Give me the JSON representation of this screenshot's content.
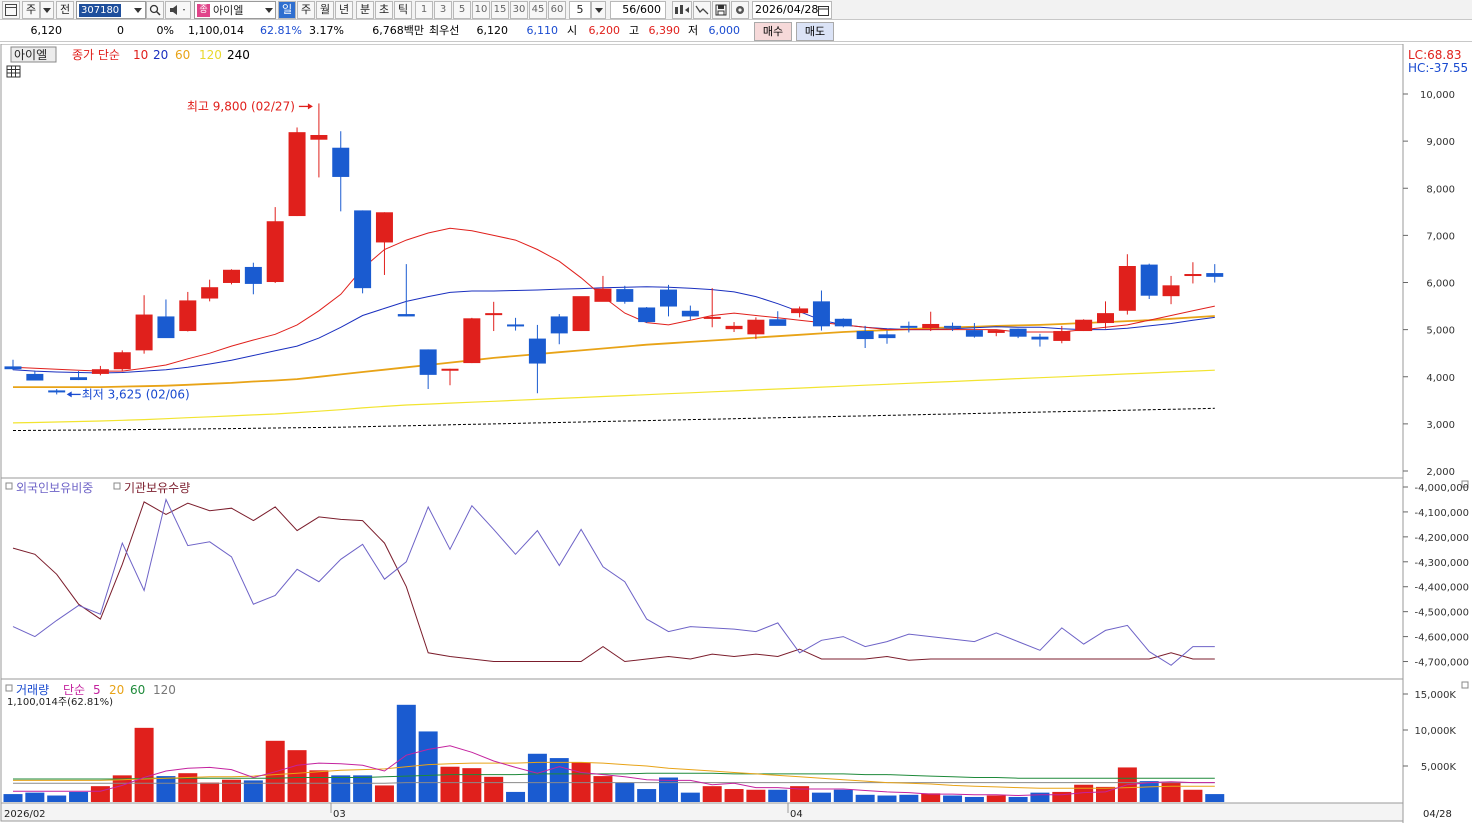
{
  "toolbar": {
    "mode_buttons": [
      "주",
      "전"
    ],
    "code": "307180",
    "stock_name": "아이엘",
    "stock_badge": "종",
    "periods": [
      "일",
      "주",
      "월",
      "년",
      "분",
      "초",
      "틱"
    ],
    "active_period": "일",
    "minute_steps": [
      "1",
      "3",
      "5",
      "10",
      "15",
      "30",
      "45",
      "60"
    ],
    "step_value": "5",
    "count": "56/600",
    "date": "2026/04/28"
  },
  "quote": {
    "price": "6,120",
    "change": "0",
    "change_pct": "0%",
    "volume": "1,100,014",
    "vol_ratio": "62.81%",
    "turnover": "3.17%",
    "amount": "6,768백만",
    "best_label": "최우선",
    "best_ask": "6,120",
    "best_bid": "6,110",
    "open_label": "시",
    "open": "6,200",
    "high_label": "고",
    "high": "6,390",
    "low_label": "저",
    "low": "6,000",
    "buy_label": "매수",
    "sell_label": "매도"
  },
  "price_panel": {
    "name_tag": "아이엘",
    "legend_prefix": "종가 단순",
    "ma_labels": [
      "10",
      "20",
      "60",
      "120",
      "240"
    ],
    "lc": "LC:68.83",
    "hc": "HC:-37.55",
    "high_note": "최고 9,800 (02/27)",
    "low_note": "최저 3,625 (02/06)",
    "y_ticks": [
      "10,000",
      "9,000",
      "8,000",
      "7,000",
      "6,000",
      "5,000",
      "4,000",
      "3,000",
      "2,000"
    ]
  },
  "holdings_panel": {
    "legend_foreign": "외국인보유비중",
    "legend_inst": "기관보유수량",
    "y_ticks": [
      "-4,000,000",
      "-4,100,000",
      "-4,200,000",
      "-4,300,000",
      "-4,400,000",
      "-4,500,000",
      "-4,600,000",
      "-4,700,000"
    ]
  },
  "volume_panel": {
    "legend_prefix": "거래량",
    "legend_ma_prefix": "단순",
    "ma_labels": [
      "5",
      "20",
      "60",
      "120"
    ],
    "current": "1,100,014주(62.81%)",
    "y_ticks": [
      "15,000K",
      "10,000K",
      "5,000K"
    ]
  },
  "xaxis": {
    "labels": [
      "2026/02",
      "03",
      "04"
    ],
    "last_date": "04/28"
  },
  "colors": {
    "up": "#e0201c",
    "down": "#1a5bd0",
    "ma10": "#e0201c",
    "ma20": "#1a2fbf",
    "ma60": "#e8a317",
    "ma120": "#f2e430",
    "ma240": "#000000",
    "foreign_line": "#6e63c7",
    "inst_line": "#7b1d2c"
  },
  "chart_data": {
    "type": "candlestick",
    "candles": [
      {
        "o": 4220,
        "h": 4360,
        "l": 4140,
        "c": 4160
      },
      {
        "o": 4060,
        "h": 4130,
        "l": 3990,
        "c": 3920
      },
      {
        "o": 3710,
        "h": 3740,
        "l": 3625,
        "c": 3700
      },
      {
        "o": 3990,
        "h": 4120,
        "l": 3930,
        "c": 3930
      },
      {
        "o": 4060,
        "h": 4230,
        "l": 4030,
        "c": 4160
      },
      {
        "o": 4160,
        "h": 4560,
        "l": 4120,
        "c": 4520
      },
      {
        "o": 4560,
        "h": 5730,
        "l": 4490,
        "c": 5320
      },
      {
        "o": 5280,
        "h": 5640,
        "l": 4870,
        "c": 4820
      },
      {
        "o": 4970,
        "h": 5800,
        "l": 4960,
        "c": 5620
      },
      {
        "o": 5660,
        "h": 6060,
        "l": 5600,
        "c": 5900
      },
      {
        "o": 5990,
        "h": 6280,
        "l": 5960,
        "c": 6270
      },
      {
        "o": 6330,
        "h": 6420,
        "l": 5750,
        "c": 5970
      },
      {
        "o": 6010,
        "h": 7600,
        "l": 5990,
        "c": 7300
      },
      {
        "o": 7410,
        "h": 9290,
        "l": 7410,
        "c": 9190
      },
      {
        "o": 9030,
        "h": 9800,
        "l": 8230,
        "c": 9130
      },
      {
        "o": 8860,
        "h": 9210,
        "l": 7510,
        "c": 8240
      },
      {
        "o": 7530,
        "h": 7530,
        "l": 5770,
        "c": 5880
      },
      {
        "o": 6850,
        "h": 7490,
        "l": 6160,
        "c": 7490
      },
      {
        "o": 5330,
        "h": 6390,
        "l": 5280,
        "c": 5280
      },
      {
        "o": 4580,
        "h": 4580,
        "l": 3740,
        "c": 4040
      },
      {
        "o": 4170,
        "h": 4170,
        "l": 3820,
        "c": 4170
      },
      {
        "o": 4290,
        "h": 5250,
        "l": 4290,
        "c": 5240
      },
      {
        "o": 5340,
        "h": 5590,
        "l": 4970,
        "c": 5350
      },
      {
        "o": 5110,
        "h": 5250,
        "l": 4980,
        "c": 5080
      },
      {
        "o": 4810,
        "h": 5100,
        "l": 3650,
        "c": 4280
      },
      {
        "o": 5280,
        "h": 5330,
        "l": 4690,
        "c": 4920
      },
      {
        "o": 4970,
        "h": 5660,
        "l": 4970,
        "c": 5710
      },
      {
        "o": 5590,
        "h": 6140,
        "l": 5620,
        "c": 5870
      },
      {
        "o": 5860,
        "h": 5930,
        "l": 5550,
        "c": 5590
      },
      {
        "o": 5470,
        "h": 5480,
        "l": 5140,
        "c": 5160
      },
      {
        "o": 5850,
        "h": 5950,
        "l": 5280,
        "c": 5490
      },
      {
        "o": 5400,
        "h": 5510,
        "l": 5210,
        "c": 5280
      },
      {
        "o": 5250,
        "h": 5880,
        "l": 5050,
        "c": 5270
      },
      {
        "o": 5010,
        "h": 5160,
        "l": 4950,
        "c": 5080
      },
      {
        "o": 4900,
        "h": 5260,
        "l": 4800,
        "c": 5210
      },
      {
        "o": 5220,
        "h": 5390,
        "l": 5090,
        "c": 5080
      },
      {
        "o": 5350,
        "h": 5490,
        "l": 5260,
        "c": 5450
      },
      {
        "o": 5600,
        "h": 5830,
        "l": 4980,
        "c": 5070
      },
      {
        "o": 5230,
        "h": 5240,
        "l": 5050,
        "c": 5070
      },
      {
        "o": 4970,
        "h": 5080,
        "l": 4610,
        "c": 4800
      },
      {
        "o": 4900,
        "h": 4980,
        "l": 4700,
        "c": 4820
      },
      {
        "o": 5080,
        "h": 5170,
        "l": 4940,
        "c": 5060
      },
      {
        "o": 5030,
        "h": 5380,
        "l": 4970,
        "c": 5120
      },
      {
        "o": 5080,
        "h": 5150,
        "l": 4970,
        "c": 5050
      },
      {
        "o": 4990,
        "h": 5140,
        "l": 4830,
        "c": 4850
      },
      {
        "o": 4930,
        "h": 4960,
        "l": 4860,
        "c": 4990
      },
      {
        "o": 5020,
        "h": 5020,
        "l": 4820,
        "c": 4850
      },
      {
        "o": 4850,
        "h": 4910,
        "l": 4640,
        "c": 4790
      },
      {
        "o": 4760,
        "h": 5080,
        "l": 4710,
        "c": 4970
      },
      {
        "o": 4970,
        "h": 5220,
        "l": 4970,
        "c": 5210
      },
      {
        "o": 5140,
        "h": 5600,
        "l": 5020,
        "c": 5350
      },
      {
        "o": 5400,
        "h": 6600,
        "l": 5320,
        "c": 6350
      },
      {
        "o": 6380,
        "h": 6400,
        "l": 5650,
        "c": 5720
      },
      {
        "o": 5710,
        "h": 6140,
        "l": 5540,
        "c": 5940
      },
      {
        "o": 6180,
        "h": 6430,
        "l": 5980,
        "c": 6180
      },
      {
        "o": 6200,
        "h": 6390,
        "l": 6000,
        "c": 6120
      }
    ],
    "ma10": [
      4200,
      4180,
      4160,
      4140,
      4120,
      4120,
      4180,
      4250,
      4380,
      4500,
      4650,
      4780,
      4900,
      5100,
      5400,
      5750,
      6300,
      6700,
      6900,
      7050,
      7150,
      7100,
      7000,
      6900,
      6700,
      6450,
      6100,
      5700,
      5350,
      5150,
      5100,
      5200,
      5300,
      5350,
      5300,
      5250,
      5200,
      5150,
      5100,
      5050,
      5000,
      5000,
      5000,
      5000,
      5000,
      5000,
      4950,
      4950,
      4950,
      5000,
      5050,
      5100,
      5200,
      5300,
      5400,
      5500
    ],
    "ma20": [
      4150,
      4120,
      4100,
      4090,
      4080,
      4090,
      4120,
      4150,
      4200,
      4270,
      4350,
      4450,
      4550,
      4650,
      4820,
      5050,
      5300,
      5450,
      5600,
      5700,
      5790,
      5820,
      5820,
      5830,
      5840,
      5860,
      5870,
      5890,
      5900,
      5910,
      5900,
      5880,
      5850,
      5800,
      5700,
      5550,
      5380,
      5200,
      5100,
      5050,
      5020,
      5000,
      5000,
      5020,
      5040,
      5060,
      5050,
      5050,
      5020,
      5000,
      5000,
      5030,
      5080,
      5130,
      5200,
      5260
    ],
    "ma60": [
      3780,
      3780,
      3780,
      3780,
      3780,
      3790,
      3800,
      3810,
      3830,
      3850,
      3870,
      3900,
      3920,
      3950,
      4000,
      4050,
      4100,
      4150,
      4200,
      4250,
      4300,
      4350,
      4400,
      4440,
      4480,
      4520,
      4560,
      4600,
      4640,
      4680,
      4710,
      4740,
      4770,
      4800,
      4830,
      4860,
      4890,
      4920,
      4950,
      4970,
      4990,
      5010,
      5030,
      5050,
      5060,
      5080,
      5090,
      5100,
      5120,
      5140,
      5160,
      5180,
      5200,
      5230,
      5260,
      5290
    ],
    "ma120": [
      3020,
      3030,
      3040,
      3050,
      3060,
      3075,
      3090,
      3110,
      3130,
      3150,
      3170,
      3190,
      3210,
      3240,
      3270,
      3300,
      3340,
      3370,
      3400,
      3420,
      3440,
      3460,
      3480,
      3500,
      3520,
      3540,
      3560,
      3580,
      3600,
      3620,
      3640,
      3660,
      3680,
      3700,
      3720,
      3740,
      3760,
      3780,
      3800,
      3820,
      3840,
      3860,
      3880,
      3900,
      3920,
      3940,
      3960,
      3980,
      4000,
      4020,
      4040,
      4060,
      4080,
      4100,
      4120,
      4140
    ],
    "ma240": [
      2860,
      2862,
      2865,
      2868,
      2872,
      2876,
      2880,
      2885,
      2890,
      2895,
      2900,
      2906,
      2912,
      2918,
      2924,
      2930,
      2940,
      2950,
      2960,
      2970,
      2980,
      2990,
      3000,
      3010,
      3020,
      3030,
      3040,
      3050,
      3060,
      3070,
      3080,
      3090,
      3100,
      3110,
      3120,
      3130,
      3140,
      3150,
      3160,
      3170,
      3180,
      3190,
      3200,
      3210,
      3220,
      3230,
      3240,
      3250,
      3260,
      3270,
      3280,
      3290,
      3300,
      3310,
      3320,
      3330
    ],
    "foreign_holding": [
      -4560000,
      -4600000,
      -4535000,
      -4475000,
      -4510000,
      -4225000,
      -4415000,
      -4050000,
      -4235000,
      -4220000,
      -4280000,
      -4470000,
      -4435000,
      -4330000,
      -4380000,
      -4290000,
      -4230000,
      -4370000,
      -4300000,
      -4080000,
      -4250000,
      -4075000,
      -4170000,
      -4270000,
      -4175000,
      -4315000,
      -4170000,
      -4320000,
      -4380000,
      -4530000,
      -4580000,
      -4560000,
      -4565000,
      -4570000,
      -4580000,
      -4545000,
      -4665000,
      -4615000,
      -4600000,
      -4640000,
      -4620000,
      -4590000,
      -4600000,
      -4610000,
      -4620000,
      -4585000,
      -4620000,
      -4655000,
      -4565000,
      -4630000,
      -4575000,
      -4555000,
      -4660000,
      -4715000,
      -4640000,
      -4640000
    ],
    "inst_holding": [
      -4245000,
      -4270000,
      -4350000,
      -4470000,
      -4530000,
      -4310000,
      -4060000,
      -4110000,
      -4065000,
      -4095000,
      -4085000,
      -4135000,
      -4080000,
      -4175000,
      -4120000,
      -4130000,
      -4135000,
      -4225000,
      -4400000,
      -4665000,
      -4680000,
      -4690000,
      -4700000,
      -4700000,
      -4700000,
      -4700000,
      -4700000,
      -4640000,
      -4700000,
      -4690000,
      -4680000,
      -4690000,
      -4670000,
      -4680000,
      -4670000,
      -4680000,
      -4650000,
      -4690000,
      -4690000,
      -4690000,
      -4680000,
      -4695000,
      -4690000,
      -4690000,
      -4690000,
      -4690000,
      -4690000,
      -4690000,
      -4690000,
      -4690000,
      -4690000,
      -4690000,
      -4690000,
      -4665000,
      -4690000,
      -4690000
    ],
    "volume_k": [
      1100,
      1300,
      900,
      1400,
      2200,
      3700,
      10300,
      3600,
      4000,
      2700,
      3100,
      3000,
      8500,
      7200,
      4400,
      3700,
      3700,
      2300,
      13500,
      9800,
      4900,
      4700,
      3500,
      1400,
      6700,
      6100,
      5500,
      3600,
      2700,
      1800,
      3400,
      1300,
      2200,
      1800,
      1700,
      1700,
      2200,
      1300,
      1700,
      1000,
      900,
      1000,
      1200,
      900,
      700,
      900,
      700,
      1300,
      1400,
      2400,
      2100,
      4800,
      2900,
      2800,
      1700,
      1100
    ],
    "volume_ma5_k": [
      1500,
      1500,
      1500,
      1500,
      1500,
      2300,
      3400,
      4300,
      4700,
      4800,
      4500,
      3400,
      4200,
      5100,
      5400,
      5300,
      5100,
      4300,
      6500,
      7300,
      7800,
      6900,
      5700,
      4800,
      4000,
      4900,
      4100,
      3800,
      3500,
      3100,
      3000,
      3000,
      2400,
      2600,
      2000,
      2000,
      1800,
      1800,
      1800,
      1600,
      1400,
      1300,
      1100,
      1100,
      1000,
      1000,
      900,
      1000,
      1000,
      1300,
      1400,
      2400,
      2700,
      2800,
      2700,
      2700
    ],
    "volume_ma20_k": [
      3000,
      3000,
      3000,
      3000,
      3000,
      3100,
      3200,
      3300,
      3400,
      3500,
      3500,
      3600,
      3800,
      4000,
      4200,
      4400,
      4500,
      4600,
      4900,
      5200,
      5300,
      5400,
      5400,
      5400,
      5500,
      5500,
      5500,
      5400,
      5200,
      5000,
      4700,
      4500,
      4300,
      4100,
      3900,
      3700,
      3500,
      3300,
      3100,
      2900,
      2700,
      2600,
      2500,
      2300,
      2200,
      2100,
      2000,
      1900,
      1900,
      1900,
      1900,
      2000,
      2100,
      2200,
      2200,
      2200
    ],
    "volume_ma60_k": [
      3200,
      3200,
      3200,
      3200,
      3200,
      3200,
      3300,
      3300,
      3300,
      3300,
      3300,
      3300,
      3300,
      3400,
      3400,
      3400,
      3400,
      3500,
      3600,
      3700,
      3800,
      3800,
      3800,
      3800,
      3900,
      3900,
      3900,
      3900,
      3900,
      4000,
      4000,
      4000,
      4000,
      3900,
      3900,
      3900,
      3900,
      3900,
      3900,
      3800,
      3800,
      3700,
      3600,
      3500,
      3400,
      3400,
      3300,
      3300,
      3300,
      3300,
      3300,
      3300,
      3300,
      3300,
      3300,
      3300
    ],
    "volume_ma120_k": [
      2600,
      2600,
      2600,
      2600,
      2600,
      2600,
      2600,
      2600,
      2600,
      2600,
      2600,
      2600,
      2600,
      2600,
      2600,
      2600,
      2600,
      2600,
      2700,
      2700,
      2700,
      2700,
      2700,
      2700,
      2700,
      2700,
      2700,
      2700,
      2700,
      2700,
      2700,
      2700,
      2700,
      2700,
      2700,
      2700,
      2700,
      2700,
      2700,
      2700,
      2700,
      2700,
      2700,
      2700,
      2700,
      2700,
      2700,
      2700,
      2700,
      2700,
      2700,
      2700,
      2700,
      2700,
      2700,
      2700
    ],
    "price_ylim": [
      2000,
      10000
    ],
    "holdings_ylim": [
      -4750000,
      -3980000
    ],
    "volume_ylim": [
      0,
      15000
    ]
  }
}
